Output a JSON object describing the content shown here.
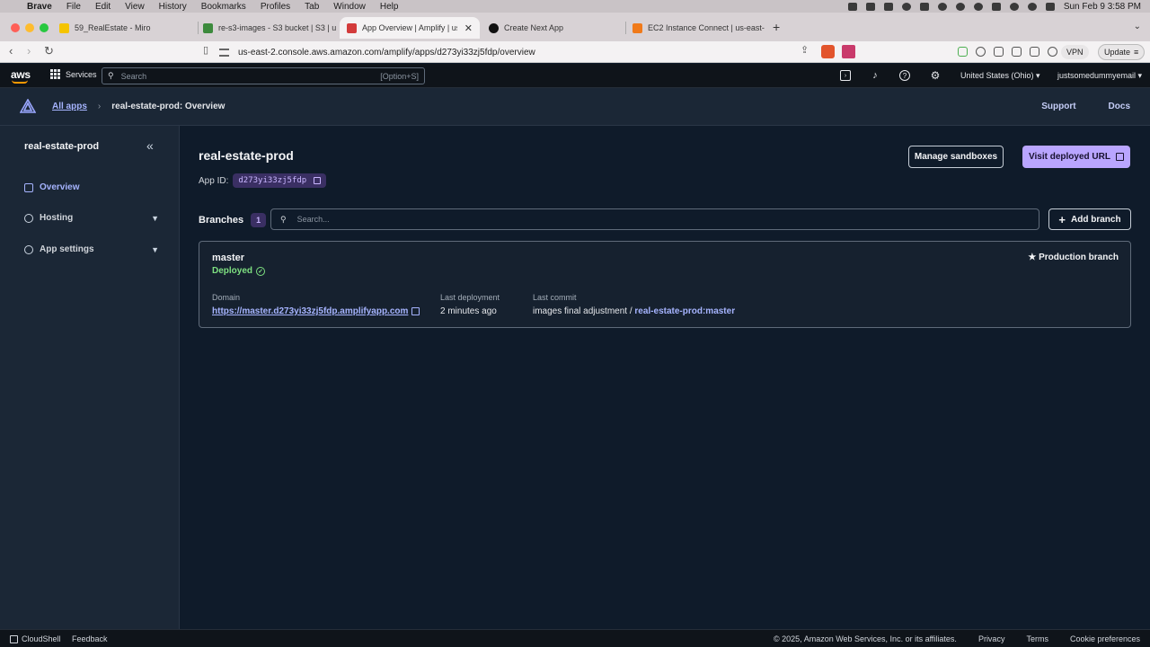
{
  "menubar": {
    "app": "Brave",
    "items": [
      "File",
      "Edit",
      "View",
      "History",
      "Bookmarks",
      "Profiles",
      "Tab",
      "Window",
      "Help"
    ],
    "clock": "Sun Feb 9  3:58 PM"
  },
  "tabs": [
    {
      "label": "59_RealEstate - Miro",
      "color": "#f5c400"
    },
    {
      "label": "re-s3-images - S3 bucket | S3 | u",
      "color": "#3d8a3d"
    },
    {
      "label": "App Overview | Amplify | us-e",
      "color": "#d33b3b"
    },
    {
      "label": "Create Next App",
      "color": "#111111"
    },
    {
      "label": "EC2 Instance Connect | us-east-",
      "color": "#f07a1a"
    }
  ],
  "address": {
    "url": "us-east-2.console.aws.amazon.com/amplify/apps/d273yi33zj5fdp/overview",
    "vpn_label": "VPN",
    "update_label": "Update"
  },
  "awsnav": {
    "logo": "aws",
    "services_label": "Services",
    "search_placeholder": "Search",
    "search_shortcut": "[Option+S]",
    "region": "United States (Ohio) ▾",
    "account": "justsomedummyemail ▾"
  },
  "header": {
    "all_apps": "All apps",
    "current": "real-estate-prod: Overview",
    "support": "Support",
    "docs": "Docs"
  },
  "sidebar": {
    "title": "real-estate-prod",
    "items": [
      {
        "label": "Overview"
      },
      {
        "label": "Hosting"
      },
      {
        "label": "App settings"
      }
    ]
  },
  "main": {
    "title": "real-estate-prod",
    "app_id_label": "App ID:",
    "app_id": "d273yi33zj5fdp",
    "manage_sandboxes": "Manage sandboxes",
    "visit_url": "Visit deployed URL",
    "branches_label": "Branches",
    "branches_count": "1",
    "search_placeholder": "Search...",
    "add_branch": "Add branch"
  },
  "branch": {
    "name": "master",
    "status": "Deployed",
    "production_label": "★ Production branch",
    "domain_label": "Domain",
    "domain": "https://master.d273yi33zj5fdp.amplifyapp.com",
    "last_deployment_label": "Last deployment",
    "last_deployment": "2 minutes ago",
    "last_commit_label": "Last commit",
    "commit_message": "images final adjustment / ",
    "commit_branch": "real-estate-prod:master"
  },
  "footer": {
    "cloudshell": "CloudShell",
    "feedback": "Feedback",
    "copyright": "© 2025, Amazon Web Services, Inc. or its affiliates.",
    "privacy": "Privacy",
    "terms": "Terms",
    "cookies": "Cookie preferences"
  },
  "colors": {
    "accent": "#a6b4ff",
    "primary_button": "#b9a5ff",
    "success": "#7ee081",
    "aws_orange": "#ff9900"
  }
}
